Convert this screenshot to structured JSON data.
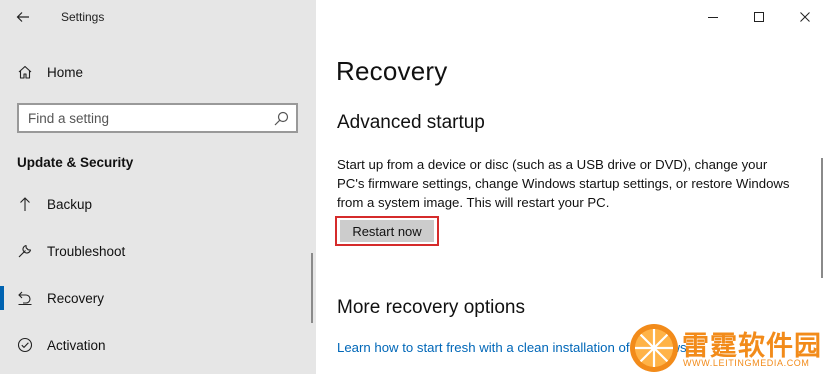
{
  "window": {
    "app_title": "Settings",
    "controls": {
      "minimize_icon": "minimize-icon",
      "maximize_icon": "maximize-icon",
      "close_icon": "close-icon"
    }
  },
  "sidebar": {
    "home_label": "Home",
    "search_placeholder": "Find a setting",
    "section_title": "Update & Security",
    "items": [
      {
        "label": "Backup",
        "icon": "backup-arrow-icon"
      },
      {
        "label": "Troubleshoot",
        "icon": "wrench-icon"
      },
      {
        "label": "Recovery",
        "icon": "recovery-icon",
        "selected": true
      },
      {
        "label": "Activation",
        "icon": "activation-check-icon"
      }
    ]
  },
  "main": {
    "page_title": "Recovery",
    "advanced_startup": {
      "heading": "Advanced startup",
      "description": "Start up from a device or disc (such as a USB drive or DVD), change your PC's firmware settings, change Windows startup settings, or restore Windows from a system image. This will restart your PC.",
      "button_label": "Restart now"
    },
    "more_options": {
      "heading": "More recovery options",
      "link": "Learn how to start fresh with a clean installation of Windows"
    }
  },
  "watermark": {
    "text": "雷霆软件园",
    "sub": "WWW.LEITINGMEDIA.COM"
  },
  "colors": {
    "sidebar_bg": "#e6e6e6",
    "accent": "#0063b1",
    "link": "#0067b8",
    "highlight": "#d52b2b",
    "watermark": "#f28b1a"
  }
}
